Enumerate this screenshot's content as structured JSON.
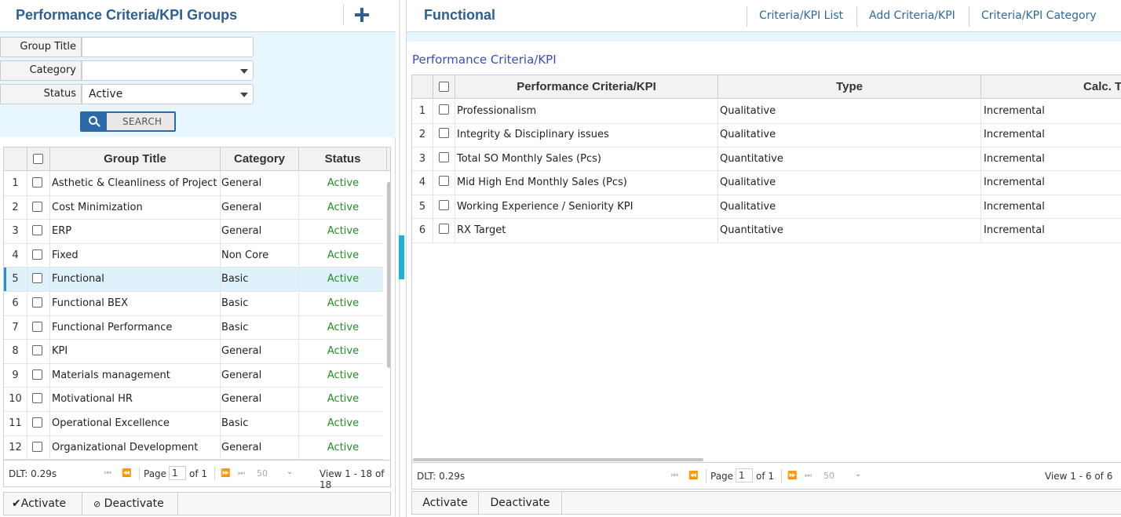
{
  "left": {
    "title": "Performance Criteria/KPI Groups",
    "filters": {
      "group_title_label": "Group Title",
      "group_title_value": "",
      "category_label": "Category",
      "category_value": "",
      "status_label": "Status",
      "status_value": "Active",
      "search_label": "SEARCH"
    },
    "table": {
      "columns": [
        "Group Title",
        "Category",
        "Status"
      ],
      "rows": [
        {
          "n": "1",
          "title": "Asthetic & Cleanliness of Project",
          "category": "General",
          "status": "Active"
        },
        {
          "n": "2",
          "title": "Cost Minimization",
          "category": "General",
          "status": "Active"
        },
        {
          "n": "3",
          "title": "ERP",
          "category": "General",
          "status": "Active"
        },
        {
          "n": "4",
          "title": "Fixed",
          "category": "Non Core",
          "status": "Active"
        },
        {
          "n": "5",
          "title": "Functional",
          "category": "Basic",
          "status": "Active"
        },
        {
          "n": "6",
          "title": "Functional BEX",
          "category": "Basic",
          "status": "Active"
        },
        {
          "n": "7",
          "title": "Functional Performance",
          "category": "Basic",
          "status": "Active"
        },
        {
          "n": "8",
          "title": "KPI",
          "category": "General",
          "status": "Active"
        },
        {
          "n": "9",
          "title": "Materials management",
          "category": "General",
          "status": "Active"
        },
        {
          "n": "10",
          "title": "Motivational HR",
          "category": "General",
          "status": "Active"
        },
        {
          "n": "11",
          "title": "Operational Excellence",
          "category": "Basic",
          "status": "Active"
        },
        {
          "n": "12",
          "title": "Organizational Development",
          "category": "General",
          "status": "Active"
        }
      ],
      "selected_row": "5"
    },
    "pager": {
      "dlt": "DLT: 0.29s",
      "page_word": "Page",
      "page_value": "1",
      "of_text": "of 1",
      "page_size": "50",
      "view": "View 1 - 18 of 18"
    },
    "actions": {
      "activate": "Activate",
      "deactivate": "Deactivate"
    }
  },
  "right": {
    "title": "Functional",
    "tabs": [
      "Criteria/KPI List",
      "Add Criteria/KPI",
      "Criteria/KPI Category"
    ],
    "section_title": "Performance Criteria/KPI",
    "table": {
      "columns": [
        "Performance Criteria/KPI",
        "Type",
        "Calc. Type"
      ],
      "rows": [
        {
          "n": "1",
          "name": "Professionalism",
          "type": "Qualitative",
          "calc": "Incremental"
        },
        {
          "n": "2",
          "name": "Integrity & Disciplinary issues",
          "type": "Qualitative",
          "calc": "Incremental"
        },
        {
          "n": "3",
          "name": "Total SO Monthly Sales (Pcs)",
          "type": "Quantitative",
          "calc": "Incremental"
        },
        {
          "n": "4",
          "name": "Mid High End Monthly Sales (Pcs)",
          "type": "Qualitative",
          "calc": "Incremental"
        },
        {
          "n": "5",
          "name": "Working Experience / Seniority KPI",
          "type": "Qualitative",
          "calc": "Incremental"
        },
        {
          "n": "6",
          "name": "RX Target",
          "type": "Quantitative",
          "calc": "Incremental"
        }
      ]
    },
    "pager": {
      "dlt": "DLT: 0.29s",
      "page_word": "Page",
      "page_value": "1",
      "of_text": "of 1",
      "page_size": "50",
      "view": "View 1 - 6 of 6"
    },
    "actions": {
      "activate": "Activate",
      "deactivate": "Deactivate"
    }
  },
  "colors": {
    "title_blue": "#2c5f94",
    "active_green": "#1f8f1f",
    "filter_bg": "#e6f6fc",
    "selected_row_bg": "#dff1fb",
    "splitter": "#1bb5d1"
  }
}
